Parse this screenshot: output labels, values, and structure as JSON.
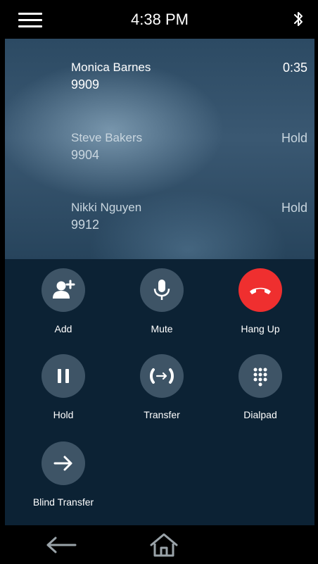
{
  "status_bar": {
    "time": "4:38 PM",
    "menu_icon": "hamburger-menu-icon",
    "bluetooth_icon": "bluetooth-icon"
  },
  "calls": [
    {
      "name": "Monica Barnes",
      "number": "9909",
      "status": "0:35",
      "state": "active"
    },
    {
      "name": "Steve Bakers",
      "number": "9904",
      "status": "Hold",
      "state": "held"
    },
    {
      "name": "Nikki Nguyen",
      "number": "9912",
      "status": "Hold",
      "state": "held"
    }
  ],
  "controls": {
    "add": {
      "label": "Add",
      "icon": "add-contact-icon"
    },
    "mute": {
      "label": "Mute",
      "icon": "microphone-icon"
    },
    "hang_up": {
      "label": "Hang Up",
      "icon": "hang-up-icon",
      "color": "#ef2f2f"
    },
    "hold": {
      "label": "Hold",
      "icon": "pause-icon"
    },
    "transfer": {
      "label": "Transfer",
      "icon": "transfer-call-icon"
    },
    "dialpad": {
      "label": "Dialpad",
      "icon": "dialpad-icon"
    },
    "blind_transfer": {
      "label": "Blind Transfer",
      "icon": "arrow-right-icon"
    }
  },
  "nav": {
    "back_icon": "back-arrow-icon",
    "home_icon": "home-icon"
  },
  "colors": {
    "controls_background": "#0c2234",
    "button_background": "#3e5466",
    "hang_up": "#ef2f2f"
  }
}
